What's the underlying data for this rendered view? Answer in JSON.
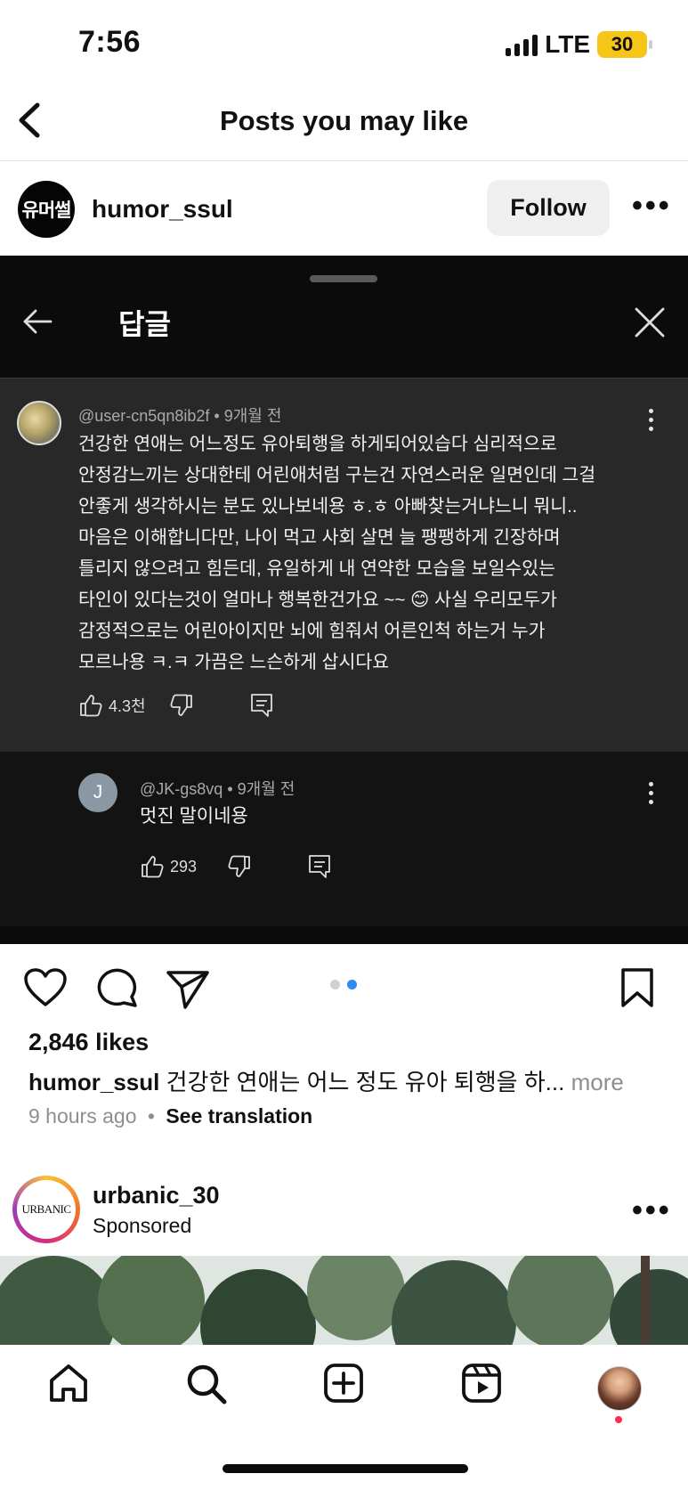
{
  "status_bar": {
    "time": "7:56",
    "network": "LTE",
    "battery": "30"
  },
  "header": {
    "title": "Posts you may like"
  },
  "post": {
    "avatar_text": "유머썰",
    "username": "humor_ssul",
    "follow_label": "Follow",
    "more_label": "•••",
    "media": {
      "sheet_title": "답글",
      "comment": {
        "handle": "@user-cn5qn8ib2f",
        "time": "9개월 전",
        "text": "건강한 연애는 어느정도 유아퇴행을 하게되어있습다 심리적으로\n안정감느끼는 상대한테 어린애처럼 구는건 자연스러운 일면인데 그걸\n안좋게 생각하시는 분도 있나보네용 ㅎ.ㅎ 아빠찾는거냐느니 뭐니..\n마음은 이해합니다만, 나이 먹고 사회 살면 늘 팽팽하게 긴장하며\n틀리지 않으려고 힘든데,  유일하게 내 연약한 모습을 보일수있는\n타인이 있다는것이 얼마나 행복한건가요 ~~ 😊  사실 우리모두가\n감정적으로는 어린아이지만 뇌에 힘줘서 어른인척 하는거 누가\n모르나용 ㅋ.ㅋ 가끔은 느슨하게 삽시다요",
        "likes": "4.3천"
      },
      "reply": {
        "avatar_letter": "J",
        "handle": "@JK-gs8vq",
        "time": "9개월 전",
        "text": "멋진 말이네용",
        "likes": "293"
      }
    },
    "likes_text": "2,846 likes",
    "caption_user": "humor_ssul",
    "caption_text": "건강한 연애는 어느 정도 유아 퇴행을 하...",
    "caption_more": "more",
    "time_ago": "9 hours ago",
    "separator": "•",
    "see_translation": "See translation",
    "carousel": {
      "count": 2,
      "active_index": 1
    }
  },
  "sponsored_post": {
    "avatar_text": "URBANIC",
    "username": "urbanic_30",
    "label": "Sponsored",
    "more_label": "•••"
  },
  "bottom_nav": {
    "items": [
      "home-icon",
      "search-icon",
      "create-icon",
      "reels-icon",
      "profile-avatar"
    ]
  },
  "colors": {
    "accent": "#2f8bf5",
    "battery": "#f5c518",
    "notification": "#ff2b52"
  }
}
